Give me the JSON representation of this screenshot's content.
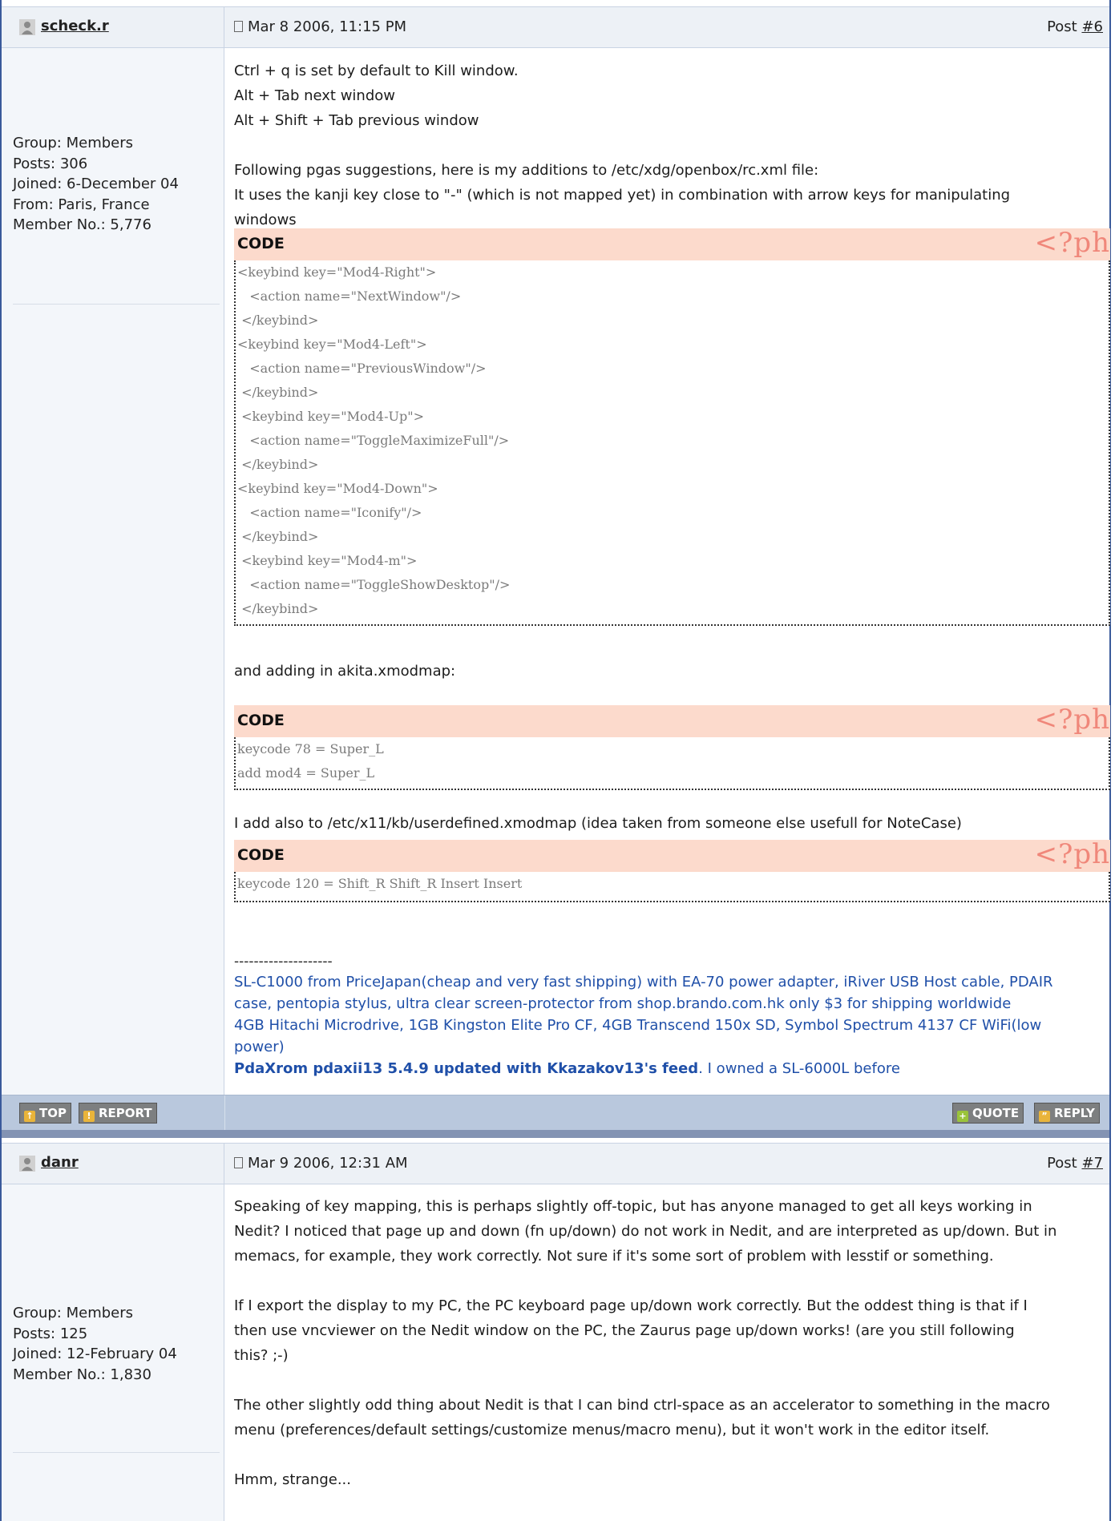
{
  "posts": [
    {
      "author": "scheck.r",
      "date": "Mar 8 2006, 11:15 PM",
      "post_label": "Post ",
      "post_num": "#6",
      "user_info": [
        "Group: Members",
        "Posts: 306",
        "Joined: 6-December 04",
        "From: Paris, France",
        "Member No.: 5,776"
      ],
      "paras": [
        "Ctrl + q is set by default to Kill window.",
        "Alt + Tab next window",
        "Alt + Shift + Tab previous window",
        "Following pgas suggestions, here is my additions to /etc/xdg/openbox/rc.xml file:",
        "It uses the kanji key close to \"-\" (which is not mapped yet) in combination with arrow keys for manipulating",
        "windows"
      ],
      "code_label": "CODE",
      "php_mark": "<?ph",
      "code1": [
        "<keybind key=\"Mod4-Right\">",
        "   <action name=\"NextWindow\"/>",
        " </keybind>",
        "<keybind key=\"Mod4-Left\">",
        "   <action name=\"PreviousWindow\"/>",
        " </keybind>",
        " <keybind key=\"Mod4-Up\">",
        "   <action name=\"ToggleMaximizeFull\"/>",
        " </keybind>",
        "<keybind key=\"Mod4-Down\">",
        "   <action name=\"Iconify\"/>",
        " </keybind>",
        " <keybind key=\"Mod4-m\">",
        "   <action name=\"ToggleShowDesktop\"/>",
        " </keybind>"
      ],
      "text_after1": "and adding in akita.xmodmap:",
      "code2": [
        "keycode 78 = Super_L",
        "add mod4 = Super_L"
      ],
      "text_after2": "I add also to /etc/x11/kb/userdefined.xmodmap (idea taken from someone else usefull for NoteCase)",
      "code3": [
        "keycode 120 = Shift_R Shift_R Insert Insert"
      ],
      "sig_dashes": "--------------------",
      "sig_lines": [
        "SL-C1000 from PriceJapan(cheap and very fast shipping) with EA-70 power adapter, iRiver USB Host cable, PDAIR",
        "case, pentopia stylus, ultra clear screen-protector from shop.brando.com.hk only $3 for shipping worldwide",
        "4GB Hitachi Microdrive, 1GB Kingston Elite Pro CF, 4GB Transcend 150x SD, Symbol Spectrum 4137 CF WiFi(low",
        "power)"
      ],
      "sig_bold": "PdaXrom pdaxii13 5.4.9 updated with Kkazakov13's feed",
      "sig_tail": ". I owned a SL-6000L before"
    },
    {
      "author": "danr",
      "date": "Mar 9 2006, 12:31 AM",
      "post_label": "Post ",
      "post_num": "#7",
      "user_info": [
        "Group: Members",
        "Posts: 125",
        "Joined: 12-February 04",
        "Member No.: 1,830"
      ],
      "paras": [
        "Speaking of key mapping, this is perhaps slightly off-topic, but has anyone managed to get all keys working in",
        "Nedit? I noticed that page up and down (fn up/down) do not work in Nedit, and are interpreted as up/down. But in",
        "memacs, for example, they work correctly. Not sure if it's some sort of problem with lesstif or something.",
        "If I export the display to my PC, the PC keyboard page up/down work correctly. But the oddest thing is that if I",
        "then use vncviewer on the Nedit window on the PC, the Zaurus page up/down works! (are you still following",
        "this? ;-)",
        "The other slightly odd thing about Nedit is that I can bind ctrl-space as an accelerator to something in the macro",
        "menu (preferences/default settings/customize menus/macro menu), but it won't work in the editor itself.",
        "Hmm, strange..."
      ]
    }
  ],
  "buttons": {
    "top": "TOP",
    "report": "REPORT",
    "quote": "QUOTE",
    "reply": "REPLY"
  },
  "colors": {
    "header_bg": "#edf1f6",
    "code_head": "#fcdacc",
    "link": "#1f4fa8",
    "bar": "#b9c8dd",
    "divider": "#8393b3"
  }
}
